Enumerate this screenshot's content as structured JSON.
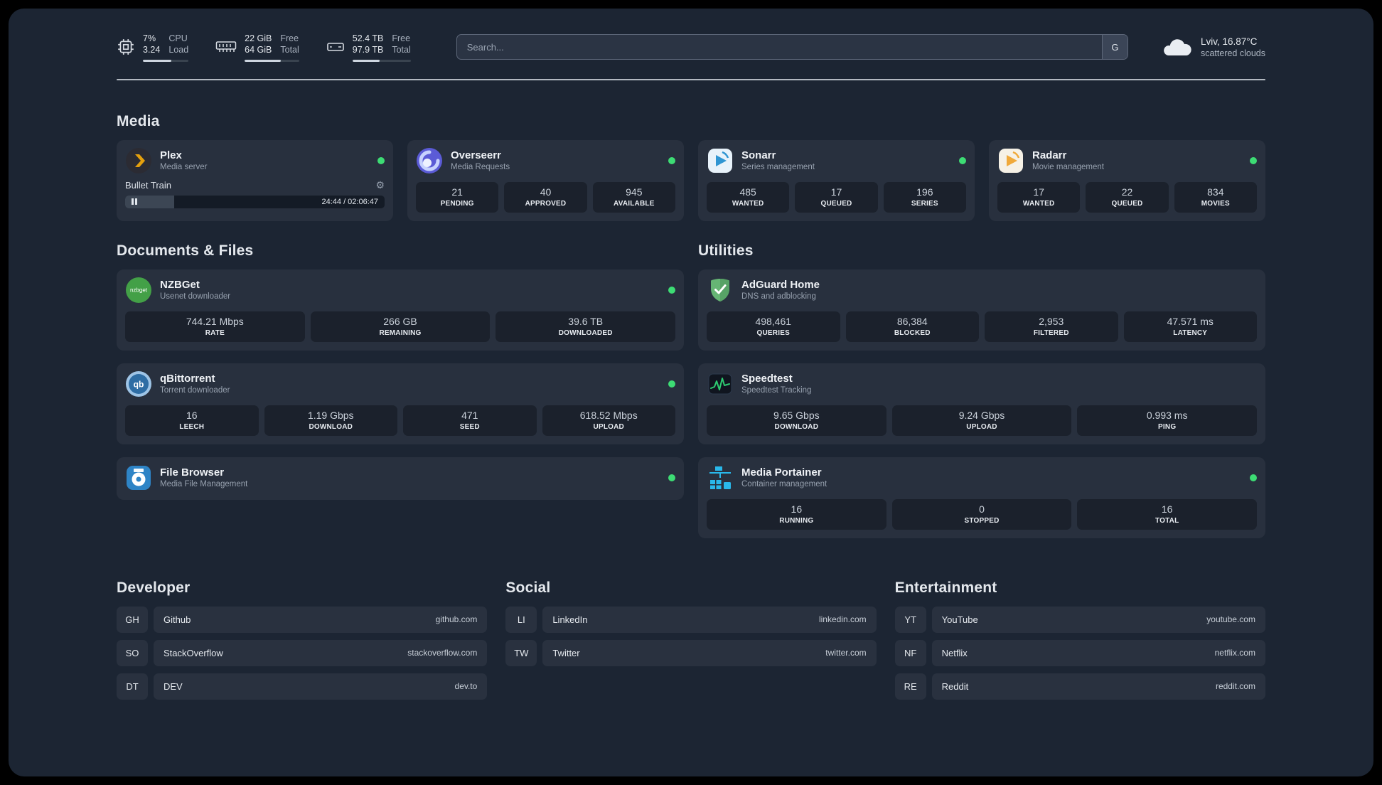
{
  "colors": {
    "status_online": "#3ddc74",
    "accent_bar": "#cdd5df"
  },
  "icons": {
    "gear": "⚙"
  },
  "topbar": {
    "cpu": {
      "value_top": "7%",
      "value_bottom": "3.24",
      "label_top": "CPU",
      "label_bottom": "Load",
      "bar_percent": 62
    },
    "memory": {
      "value_top": "22 GiB",
      "value_bottom": "64 GiB",
      "label_top": "Free",
      "label_bottom": "Total",
      "bar_percent": 66
    },
    "disk": {
      "value_top": "52.4 TB",
      "value_bottom": "97.9 TB",
      "label_top": "Free",
      "label_bottom": "Total",
      "bar_percent": 47
    },
    "search": {
      "placeholder": "Search...",
      "button_label": "G"
    },
    "weather": {
      "location": "Lviv, 16.87°C",
      "condition": "scattered clouds"
    }
  },
  "sections": {
    "media": {
      "title": "Media",
      "cards": [
        {
          "name": "Plex",
          "subtitle": "Media server",
          "status": "online",
          "player": {
            "track": "Bullet Train",
            "time": "24:44 / 02:06:47",
            "progress_percent": 19
          }
        },
        {
          "name": "Overseerr",
          "subtitle": "Media Requests",
          "status": "online",
          "stats": [
            {
              "value": "21",
              "label": "PENDING"
            },
            {
              "value": "40",
              "label": "APPROVED"
            },
            {
              "value": "945",
              "label": "AVAILABLE"
            }
          ]
        },
        {
          "name": "Sonarr",
          "subtitle": "Series management",
          "status": "online",
          "stats": [
            {
              "value": "485",
              "label": "WANTED"
            },
            {
              "value": "17",
              "label": "QUEUED"
            },
            {
              "value": "196",
              "label": "SERIES"
            }
          ]
        },
        {
          "name": "Radarr",
          "subtitle": "Movie management",
          "status": "online",
          "stats": [
            {
              "value": "17",
              "label": "WANTED"
            },
            {
              "value": "22",
              "label": "QUEUED"
            },
            {
              "value": "834",
              "label": "MOVIES"
            }
          ]
        }
      ]
    },
    "documents": {
      "title": "Documents & Files",
      "cards": [
        {
          "name": "NZBGet",
          "subtitle": "Usenet downloader",
          "status": "online",
          "icon_text": "nzbget",
          "stats": [
            {
              "value": "744.21 Mbps",
              "label": "RATE"
            },
            {
              "value": "266 GB",
              "label": "REMAINING"
            },
            {
              "value": "39.6 TB",
              "label": "DOWNLOADED"
            }
          ]
        },
        {
          "name": "qBittorrent",
          "subtitle": "Torrent downloader",
          "status": "online",
          "icon_text": "qb",
          "stats": [
            {
              "value": "16",
              "label": "LEECH"
            },
            {
              "value": "1.19 Gbps",
              "label": "DOWNLOAD"
            },
            {
              "value": "471",
              "label": "SEED"
            },
            {
              "value": "618.52 Mbps",
              "label": "UPLOAD"
            }
          ]
        },
        {
          "name": "File Browser",
          "subtitle": "Media File Management",
          "status": "online"
        }
      ]
    },
    "utilities": {
      "title": "Utilities",
      "cards": [
        {
          "name": "AdGuard Home",
          "subtitle": "DNS and adblocking",
          "stats": [
            {
              "value": "498,461",
              "label": "QUERIES"
            },
            {
              "value": "86,384",
              "label": "BLOCKED"
            },
            {
              "value": "2,953",
              "label": "FILTERED"
            },
            {
              "value": "47.571 ms",
              "label": "LATENCY"
            }
          ]
        },
        {
          "name": "Speedtest",
          "subtitle": "Speedtest Tracking",
          "stats": [
            {
              "value": "9.65 Gbps",
              "label": "DOWNLOAD"
            },
            {
              "value": "9.24 Gbps",
              "label": "UPLOAD"
            },
            {
              "value": "0.993 ms",
              "label": "PING"
            }
          ]
        },
        {
          "name": "Media Portainer",
          "subtitle": "Container management",
          "status": "online",
          "stats": [
            {
              "value": "16",
              "label": "RUNNING"
            },
            {
              "value": "0",
              "label": "STOPPED"
            },
            {
              "value": "16",
              "label": "TOTAL"
            }
          ]
        }
      ]
    },
    "links": [
      {
        "title": "Developer",
        "items": [
          {
            "abbr": "GH",
            "name": "Github",
            "url": "github.com"
          },
          {
            "abbr": "SO",
            "name": "StackOverflow",
            "url": "stackoverflow.com"
          },
          {
            "abbr": "DT",
            "name": "DEV",
            "url": "dev.to"
          }
        ]
      },
      {
        "title": "Social",
        "items": [
          {
            "abbr": "LI",
            "name": "LinkedIn",
            "url": "linkedin.com"
          },
          {
            "abbr": "TW",
            "name": "Twitter",
            "url": "twitter.com"
          }
        ]
      },
      {
        "title": "Entertainment",
        "items": [
          {
            "abbr": "YT",
            "name": "YouTube",
            "url": "youtube.com"
          },
          {
            "abbr": "NF",
            "name": "Netflix",
            "url": "netflix.com"
          },
          {
            "abbr": "RE",
            "name": "Reddit",
            "url": "reddit.com"
          }
        ]
      }
    ]
  }
}
